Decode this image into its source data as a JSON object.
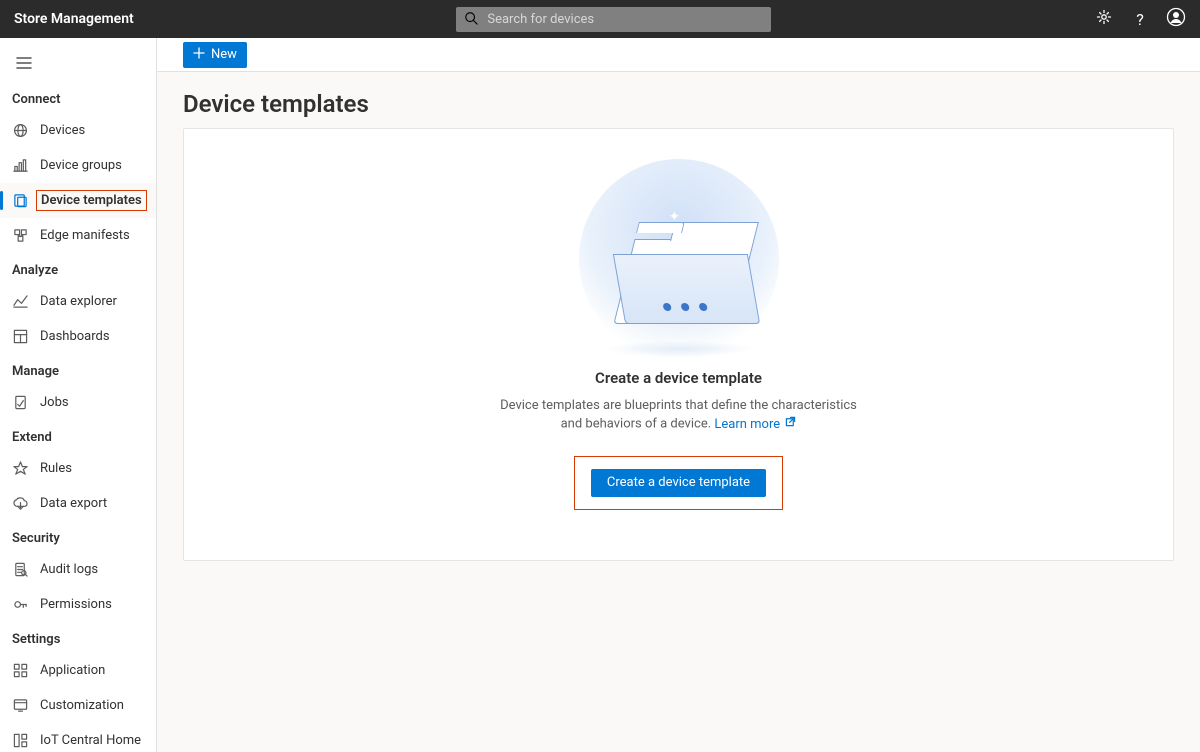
{
  "header": {
    "title": "Store Management",
    "search_placeholder": "Search for devices"
  },
  "sidebar": {
    "sections": [
      {
        "label": "Connect",
        "items": [
          {
            "label": "Devices",
            "icon": "world-icon"
          },
          {
            "label": "Device groups",
            "icon": "chart-icon"
          },
          {
            "label": "Device templates",
            "icon": "template-icon",
            "selected": true,
            "highlighted": true
          },
          {
            "label": "Edge manifests",
            "icon": "edge-icon"
          }
        ]
      },
      {
        "label": "Analyze",
        "items": [
          {
            "label": "Data explorer",
            "icon": "trend-icon"
          },
          {
            "label": "Dashboards",
            "icon": "dashboard-icon"
          }
        ]
      },
      {
        "label": "Manage",
        "items": [
          {
            "label": "Jobs",
            "icon": "jobs-icon"
          }
        ]
      },
      {
        "label": "Extend",
        "items": [
          {
            "label": "Rules",
            "icon": "rules-icon"
          },
          {
            "label": "Data export",
            "icon": "export-icon"
          }
        ]
      },
      {
        "label": "Security",
        "items": [
          {
            "label": "Audit logs",
            "icon": "audit-icon"
          },
          {
            "label": "Permissions",
            "icon": "permissions-icon"
          }
        ]
      },
      {
        "label": "Settings",
        "items": [
          {
            "label": "Application",
            "icon": "application-icon"
          },
          {
            "label": "Customization",
            "icon": "customization-icon"
          },
          {
            "label": "IoT Central Home",
            "icon": "home-icon"
          }
        ]
      }
    ]
  },
  "cmdbar": {
    "new_label": "New"
  },
  "page": {
    "title": "Device templates"
  },
  "empty_state": {
    "heading": "Create a device template",
    "description_prefix": "Device templates are blueprints that define the characteristics and behaviors of a device. ",
    "learn_more_label": "Learn more",
    "cta_label": "Create a device template"
  }
}
